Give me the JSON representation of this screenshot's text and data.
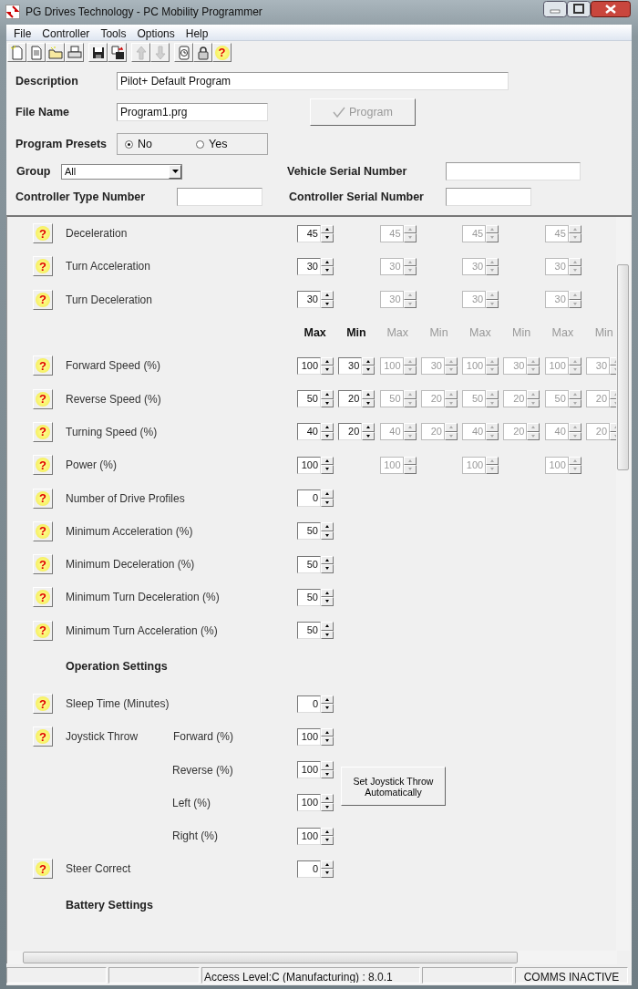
{
  "window": {
    "title": "PG Drives Technology - PC Mobility Programmer"
  },
  "menu": [
    {
      "label": "File"
    },
    {
      "label": "Controller"
    },
    {
      "label": "Tools"
    },
    {
      "label": "Options"
    },
    {
      "label": "Help"
    }
  ],
  "toolbar": [
    {
      "kind": "new",
      "disabled": false
    },
    {
      "kind": "copy",
      "disabled": false
    },
    {
      "kind": "open",
      "disabled": false
    },
    {
      "kind": "print",
      "disabled": false,
      "group_end": true
    },
    {
      "kind": "save",
      "disabled": false
    },
    {
      "kind": "saveas",
      "disabled": false,
      "group_end": true
    },
    {
      "kind": "up",
      "disabled": true
    },
    {
      "kind": "down",
      "disabled": true,
      "group_end": true
    },
    {
      "kind": "clock",
      "disabled": false
    },
    {
      "kind": "lock",
      "disabled": false
    },
    {
      "kind": "help",
      "disabled": false,
      "glyph": "?"
    }
  ],
  "form": {
    "description": {
      "label": "Description",
      "value": "Pilot+ Default Program"
    },
    "file_name": {
      "label": "File Name",
      "value": "Program1.prg"
    },
    "program_button": {
      "label": "Program",
      "disabled": true
    },
    "presets": {
      "label": "Program Presets",
      "options": [
        {
          "label": "No",
          "selected": true
        },
        {
          "label": "Yes",
          "selected": false
        }
      ]
    },
    "group": {
      "label": "Group",
      "value": "All"
    },
    "vehicle_serial": {
      "label": "Vehicle Serial Number"
    },
    "controller_type": {
      "label": "Controller Type Number"
    },
    "controller_serial": {
      "label": "Controller Serial Number"
    }
  },
  "parameters": [
    {
      "kind": "single",
      "help": "?",
      "label": "Deceleration",
      "cells": [
        {
          "value": "45",
          "disabled": false
        },
        {
          "value": "45",
          "disabled": true
        },
        {
          "value": "45",
          "disabled": true
        },
        {
          "value": "45",
          "disabled": true
        }
      ]
    },
    {
      "kind": "single",
      "help": "?",
      "label": "Turn Acceleration",
      "cells": [
        {
          "value": "30",
          "disabled": false
        },
        {
          "value": "30",
          "disabled": true
        },
        {
          "value": "30",
          "disabled": true
        },
        {
          "value": "30",
          "disabled": true
        }
      ]
    },
    {
      "kind": "single",
      "help": "?",
      "label": "Turn Deceleration",
      "cells": [
        {
          "value": "30",
          "disabled": false
        },
        {
          "value": "30",
          "disabled": true
        },
        {
          "value": "30",
          "disabled": true
        },
        {
          "value": "30",
          "disabled": true
        }
      ]
    },
    {
      "kind": "header",
      "cells": [
        {
          "text": "Max",
          "disabled": false
        },
        {
          "text": "Min",
          "disabled": false
        },
        {
          "text": "Max",
          "disabled": true
        },
        {
          "text": "Min",
          "disabled": true
        },
        {
          "text": "Max",
          "disabled": true
        },
        {
          "text": "Min",
          "disabled": true
        },
        {
          "text": "Max",
          "disabled": true
        },
        {
          "text": "Min",
          "disabled": true
        }
      ]
    },
    {
      "kind": "pair",
      "help": "?",
      "label": "Forward Speed (%)",
      "cells": [
        {
          "value": "100",
          "disabled": false
        },
        {
          "value": "30",
          "disabled": false
        },
        {
          "value": "100",
          "disabled": true
        },
        {
          "value": "30",
          "disabled": true
        },
        {
          "value": "100",
          "disabled": true
        },
        {
          "value": "30",
          "disabled": true
        },
        {
          "value": "100",
          "disabled": true
        },
        {
          "value": "30",
          "disabled": true
        }
      ]
    },
    {
      "kind": "pair",
      "help": "?",
      "label": "Reverse Speed (%)",
      "cells": [
        {
          "value": "50",
          "disabled": false
        },
        {
          "value": "20",
          "disabled": false
        },
        {
          "value": "50",
          "disabled": true
        },
        {
          "value": "20",
          "disabled": true
        },
        {
          "value": "50",
          "disabled": true
        },
        {
          "value": "20",
          "disabled": true
        },
        {
          "value": "50",
          "disabled": true
        },
        {
          "value": "20",
          "disabled": true
        }
      ]
    },
    {
      "kind": "pair",
      "help": "?",
      "label": "Turning Speed (%)",
      "cells": [
        {
          "value": "40",
          "disabled": false
        },
        {
          "value": "20",
          "disabled": false
        },
        {
          "value": "40",
          "disabled": true
        },
        {
          "value": "20",
          "disabled": true
        },
        {
          "value": "40",
          "disabled": true
        },
        {
          "value": "20",
          "disabled": true
        },
        {
          "value": "40",
          "disabled": true
        },
        {
          "value": "20",
          "disabled": true
        }
      ]
    },
    {
      "kind": "single",
      "help": "?",
      "label": "Power (%)",
      "cells": [
        {
          "value": "100",
          "disabled": false
        },
        {
          "value": "100",
          "disabled": true
        },
        {
          "value": "100",
          "disabled": true
        },
        {
          "value": "100",
          "disabled": true
        }
      ]
    },
    {
      "kind": "single",
      "help": "?",
      "label": "Number of Drive Profiles",
      "cells": [
        {
          "value": "0",
          "disabled": false
        }
      ]
    },
    {
      "kind": "single",
      "help": "?",
      "label": "Minimum Acceleration (%)",
      "cells": [
        {
          "value": "50",
          "disabled": false
        }
      ]
    },
    {
      "kind": "single",
      "help": "?",
      "label": "Minimum Deceleration (%)",
      "cells": [
        {
          "value": "50",
          "disabled": false
        }
      ]
    },
    {
      "kind": "single",
      "help": "?",
      "label": "Minimum Turn Deceleration (%)",
      "cells": [
        {
          "value": "50",
          "disabled": false
        }
      ]
    },
    {
      "kind": "single",
      "help": "?",
      "label": "Minimum Turn Acceleration (%)",
      "cells": [
        {
          "value": "50",
          "disabled": false
        }
      ]
    },
    {
      "kind": "section",
      "label": "Operation Settings"
    },
    {
      "kind": "single",
      "help": "?",
      "label": "Sleep Time (Minutes)",
      "cells": [
        {
          "value": "0",
          "disabled": false
        }
      ]
    },
    {
      "kind": "joystick",
      "help": "?",
      "label": "Joystick Throw",
      "button": "Set Joystick Throw Automatically",
      "subrows": [
        {
          "label": "Forward (%)",
          "value": "100"
        },
        {
          "label": "Reverse (%)",
          "value": "100"
        },
        {
          "label": "Left (%)",
          "value": "100"
        },
        {
          "label": "Right (%)",
          "value": "100"
        }
      ]
    },
    {
      "kind": "single",
      "help": "?",
      "label": "Steer Correct",
      "cells": [
        {
          "value": "0",
          "disabled": false
        }
      ]
    },
    {
      "kind": "section",
      "label": "Battery Settings"
    }
  ],
  "status_bar": [
    {
      "kind": "blank"
    },
    {
      "kind": "blank"
    },
    {
      "kind": "text",
      "text": "Access Level:C (Manufacturing) : 8.0.1"
    },
    {
      "kind": "blank"
    },
    {
      "kind": "text",
      "text": "COMMS INACTIVE"
    }
  ]
}
